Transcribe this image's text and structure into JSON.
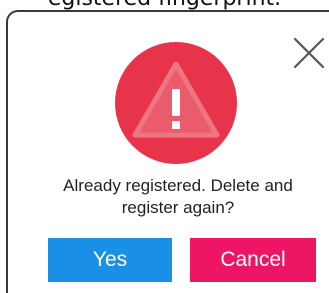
{
  "background_caption": "egistered fingerprint.",
  "dialog": {
    "icon": "warning-icon",
    "close_icon": "close-icon",
    "message": "Already registered. Delete and register again?",
    "yes_label": "Yes",
    "cancel_label": "Cancel"
  },
  "colors": {
    "warning_circle": "#e8344a",
    "yes_button": "#1a8fe6",
    "cancel_button": "#ee1564"
  }
}
